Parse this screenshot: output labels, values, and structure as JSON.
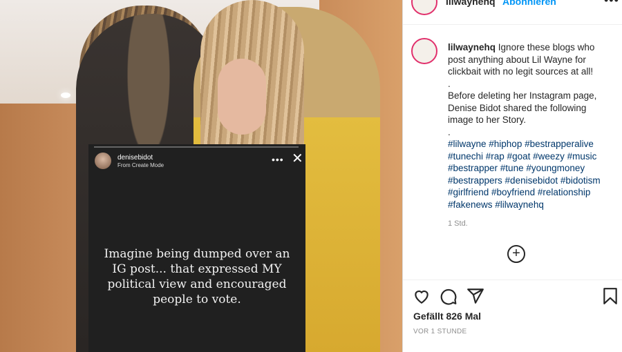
{
  "header": {
    "username": "lilwaynehq",
    "follow_label": "Abonnieren",
    "more_glyph": "•••"
  },
  "story_overlay": {
    "username": "denisebidot",
    "subtitle": "From Create Mode",
    "text": "Imagine being dumped over an IG post... that expressed MY political view and encouraged people to vote.",
    "more_glyph": "•••",
    "close_glyph": "✕"
  },
  "caption": {
    "username": "lilwaynehq",
    "line1": "Ignore these blogs who post anything about Lil Wayne for clickbait with no legit sources at all!",
    "dot1": ".",
    "line2": "Before deleting her Instagram page, Denise Bidot shared the following image to her Story.",
    "dot2": ".",
    "hashtags": "#lilwayne #hiphop #bestrapperalive #tunechi #rap #goat #weezy #music #bestrapper #tune #youngmoney #bestrappers #denisebidot #bidotism #girlfriend #boyfriend #relationship #fakenews #lilwaynehq",
    "time": "1 Std."
  },
  "actions": {
    "add_glyph": "+"
  },
  "likes_text": "Gefällt 826 Mal",
  "posted_ago": "VOR 1 STUNDE",
  "colors": {
    "link": "#0095f6",
    "hashtag": "#00376b",
    "story_ring": "#e1306c"
  },
  "icons": [
    "heart-icon",
    "comment-icon",
    "share-icon",
    "bookmark-icon",
    "add-comment-icon"
  ]
}
